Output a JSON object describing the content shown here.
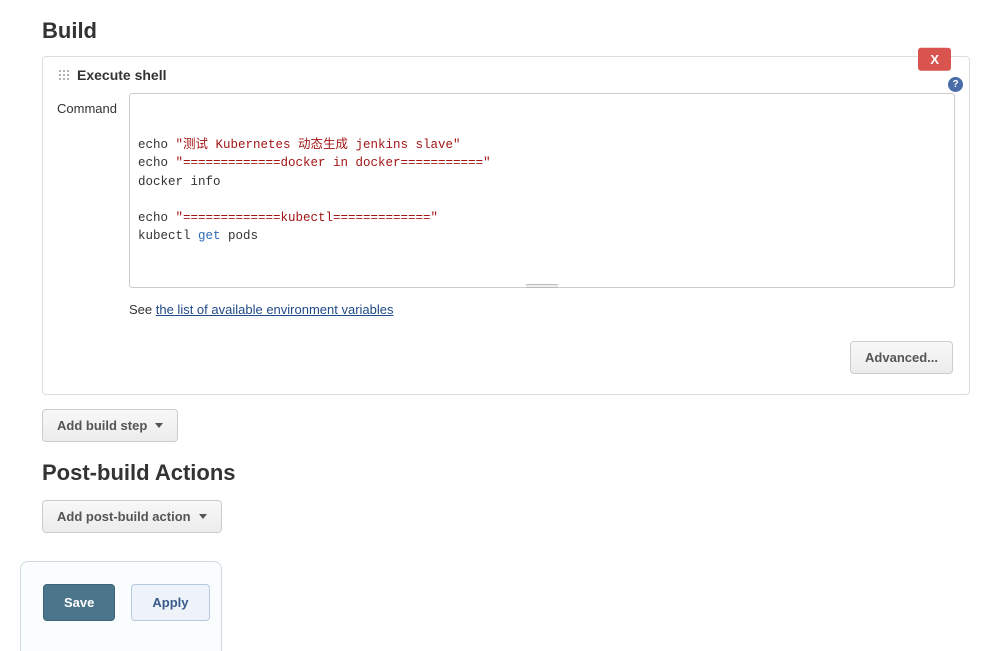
{
  "sections": {
    "build_title": "Build",
    "post_build_title": "Post-build Actions"
  },
  "build_step": {
    "header": "Execute shell",
    "delete_label": "X",
    "command_label": "Command",
    "code_lines": [
      {
        "tokens": [
          {
            "t": "echo ",
            "c": "kw"
          },
          {
            "t": "\"测试 Kubernetes 动态生成 jenkins slave\"",
            "c": "str"
          }
        ]
      },
      {
        "tokens": [
          {
            "t": "echo ",
            "c": "kw"
          },
          {
            "t": "\"=============docker in docker===========\"",
            "c": "str"
          }
        ]
      },
      {
        "tokens": [
          {
            "t": "docker info",
            "c": "cmd"
          }
        ]
      },
      {
        "tokens": [
          {
            "t": "",
            "c": "cmd"
          }
        ]
      },
      {
        "tokens": [
          {
            "t": "echo ",
            "c": "kw"
          },
          {
            "t": "\"=============kubectl=============\"",
            "c": "str"
          }
        ]
      },
      {
        "tokens": [
          {
            "t": "kubectl ",
            "c": "cmd"
          },
          {
            "t": "get",
            "c": "sub"
          },
          {
            "t": " pods",
            "c": "cmd"
          }
        ]
      }
    ],
    "see_prefix": "See ",
    "see_link": "the list of available environment variables",
    "advanced_label": "Advanced..."
  },
  "buttons": {
    "add_build_step": "Add build step",
    "add_post_build": "Add post-build action",
    "save": "Save",
    "apply": "Apply"
  }
}
